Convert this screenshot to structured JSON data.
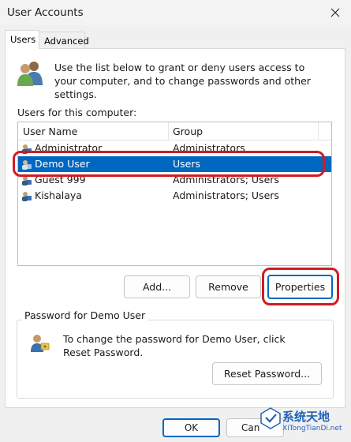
{
  "window": {
    "title": "User Accounts"
  },
  "icons": {
    "close": "close-icon",
    "users_info": "users-group-icon",
    "user_row": "user-icon",
    "password": "password-key-icon"
  },
  "tabs": [
    {
      "label": "Users",
      "active": true
    },
    {
      "label": "Advanced",
      "active": false
    }
  ],
  "users_tab": {
    "info_text": "Use the list below to grant or deny users access to your computer, and to change passwords and other settings.",
    "list_label": "Users for this computer:",
    "columns": [
      "User Name",
      "Group"
    ],
    "rows": [
      {
        "name": "Administrator",
        "group": "Administrators",
        "selected": false
      },
      {
        "name": "Demo User",
        "group": "Users",
        "selected": true
      },
      {
        "name": "Guest 999",
        "group": "Administrators; Users",
        "selected": false
      },
      {
        "name": "Kishalaya",
        "group": "Administrators; Users",
        "selected": false
      }
    ],
    "buttons": {
      "add": "Add...",
      "remove": "Remove",
      "properties": "Properties"
    },
    "password_group": {
      "title": "Password for Demo User",
      "text": "To change the password for Demo User, click Reset Password.",
      "reset_button": "Reset Password..."
    }
  },
  "footer": {
    "ok": "OK",
    "cancel": "Can"
  },
  "watermark": {
    "line1": "系统天地",
    "line2": "XiTongTianDi.net"
  },
  "colors": {
    "selection": "#0067c0",
    "highlight_ring": "#cf1c23"
  }
}
